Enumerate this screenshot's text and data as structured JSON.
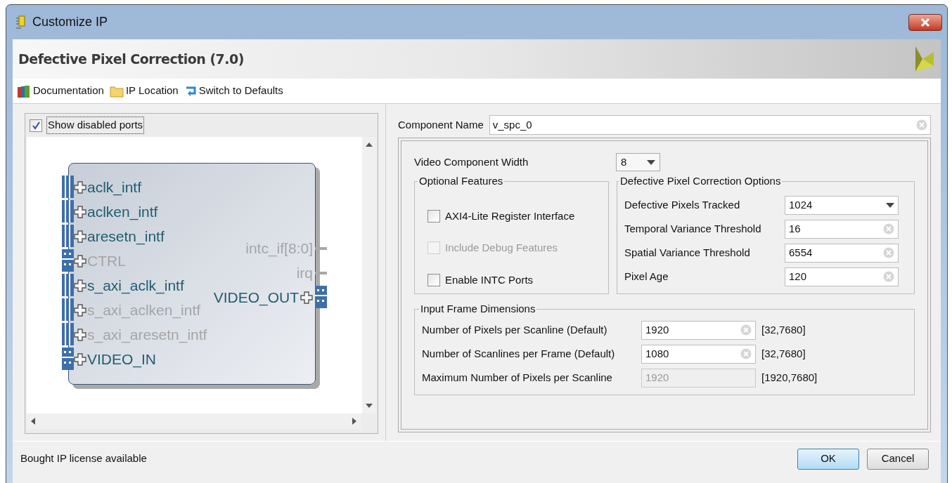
{
  "window": {
    "title": "Customize IP"
  },
  "header": {
    "title": "Defective Pixel Correction (7.0)"
  },
  "toolbar": [
    {
      "kind": "docs",
      "label": "Documentation"
    },
    {
      "kind": "folder",
      "label": "IP Location"
    },
    {
      "kind": "reset",
      "label": "Switch to Defaults"
    }
  ],
  "symbol_panel": {
    "show_disabled": {
      "label": "Show disabled ports",
      "checked": true
    },
    "left_ports": [
      {
        "name": "aclk_intf",
        "kind": "signal",
        "enabled": true
      },
      {
        "name": "aclken_intf",
        "kind": "signal",
        "enabled": true
      },
      {
        "name": "aresetn_intf",
        "kind": "signal",
        "enabled": true
      },
      {
        "name": "CTRL",
        "kind": "bus",
        "enabled": false
      },
      {
        "name": "s_axi_aclk_intf",
        "kind": "signal",
        "enabled": true
      },
      {
        "name": "s_axi_aclken_intf",
        "kind": "signal",
        "enabled": false
      },
      {
        "name": "s_axi_aresetn_intf",
        "kind": "signal",
        "enabled": false
      },
      {
        "name": "VIDEO_IN",
        "kind": "bus",
        "enabled": true
      }
    ],
    "right_ports": [
      {
        "name": "intc_if[8:0]",
        "kind": "wire",
        "enabled": false
      },
      {
        "name": "irq",
        "kind": "wire",
        "enabled": false
      },
      {
        "name": "VIDEO_OUT",
        "kind": "bus",
        "enabled": true
      }
    ]
  },
  "component_name": {
    "label": "Component Name",
    "value": "v_spc_0"
  },
  "video_width": {
    "label": "Video Component Width",
    "value": "8"
  },
  "optional_features": {
    "title": "Optional Features",
    "options": [
      {
        "label": "AXI4-Lite Register Interface",
        "checked": false,
        "disabled": false
      },
      {
        "label": "Include Debug Features",
        "checked": false,
        "disabled": true
      },
      {
        "label": "Enable INTC Ports",
        "checked": false,
        "disabled": false
      }
    ]
  },
  "dpc_options": {
    "title": "Defective Pixel Correction Options",
    "fields": [
      {
        "kind": "dropdown",
        "label": "Defective Pixels Tracked",
        "value": "1024"
      },
      {
        "kind": "text",
        "label": "Temporal Variance Threshold",
        "value": "16"
      },
      {
        "kind": "text",
        "label": "Spatial Variance Threshold",
        "value": "6554"
      },
      {
        "kind": "text",
        "label": "Pixel Age",
        "value": "120"
      }
    ]
  },
  "input_frame": {
    "title": "Input Frame Dimensions",
    "fields": [
      {
        "label": "Number of Pixels per Scanline (Default)",
        "value": "1920",
        "range": "[32,7680]",
        "disabled": false
      },
      {
        "label": "Number of Scanlines per Frame (Default)",
        "value": "1080",
        "range": "[32,7680]",
        "disabled": false
      },
      {
        "label": "Maximum Number of Pixels per Scanline",
        "value": "1920",
        "range": "[1920,7680]",
        "disabled": true
      }
    ]
  },
  "status_bar": "Bought IP license available",
  "buttons": [
    {
      "label": "OK",
      "default": true
    },
    {
      "label": "Cancel",
      "default": false
    }
  ]
}
